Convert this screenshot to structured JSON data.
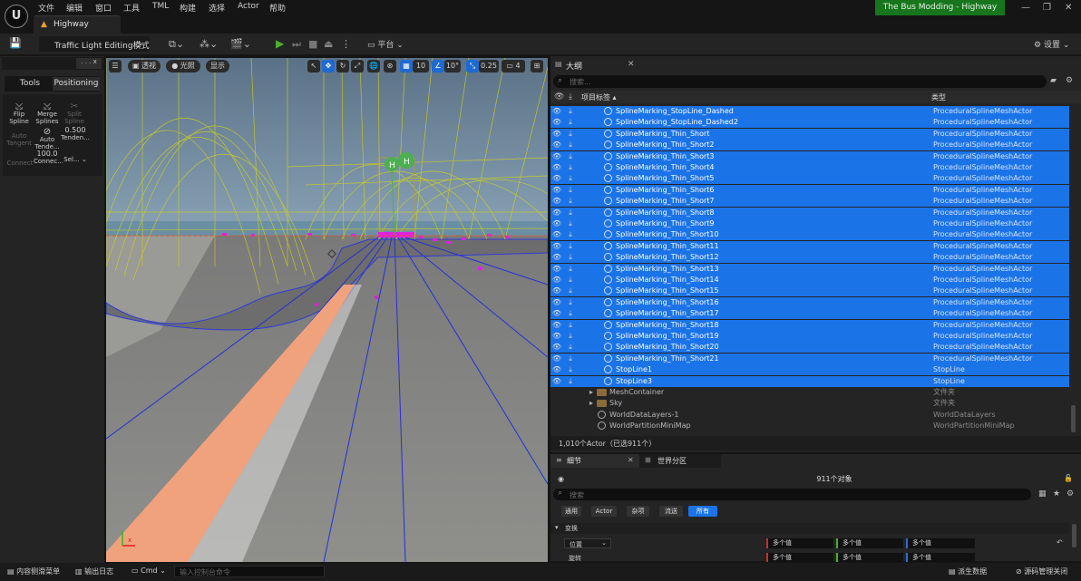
{
  "menu": [
    "文件",
    "编辑",
    "窗口",
    "工具",
    "TML",
    "构建",
    "选择",
    "Actor",
    "帮助"
  ],
  "tab": {
    "title": "Highway"
  },
  "project": "The Bus Modding - Highway",
  "toolbar": {
    "mode": "Traffic Light Editing模式",
    "platform": "平台",
    "settings": "设置"
  },
  "left_panel": {
    "tab_dots": ". . . x",
    "tabs": [
      "Tools",
      "Positioning"
    ],
    "tools": {
      "flip": "Flip Spline",
      "merge": "Merge Splines",
      "split": "Split Spline",
      "auto_tangent": "Auto Tangent",
      "auto_tende": "Auto Tende...",
      "tenden_value": "0.500",
      "tenden_label": "Tenden...",
      "connect": "Connect",
      "connect_value": "100.0",
      "connect_label": "Connec...",
      "sel": "Sel..."
    }
  },
  "viewport": {
    "perspective": "透视",
    "lit": "光照",
    "show": "显示",
    "grid_snap": "10",
    "rot_snap": "10°",
    "scale_snap": "0.25",
    "camera_speed": "4"
  },
  "outliner": {
    "title": "大纲",
    "search_placeholder": "搜索...",
    "col_label": "项目标签",
    "col_type": "类型",
    "rows": [
      {
        "name": "SplineMarking_StopLine_Dashed",
        "type": "ProceduralSplineMeshActor",
        "selected": true,
        "kind": "actor"
      },
      {
        "name": "SplineMarking_StopLine_Dashed2",
        "type": "ProceduralSplineMeshActor",
        "selected": true,
        "kind": "actor"
      },
      {
        "name": "SplineMarking_Thin_Short",
        "type": "ProceduralSplineMeshActor",
        "selected": true,
        "kind": "actor"
      },
      {
        "name": "SplineMarking_Thin_Short2",
        "type": "ProceduralSplineMeshActor",
        "selected": true,
        "kind": "actor"
      },
      {
        "name": "SplineMarking_Thin_Short3",
        "type": "ProceduralSplineMeshActor",
        "selected": true,
        "kind": "actor"
      },
      {
        "name": "SplineMarking_Thin_Short4",
        "type": "ProceduralSplineMeshActor",
        "selected": true,
        "kind": "actor"
      },
      {
        "name": "SplineMarking_Thin_Short5",
        "type": "ProceduralSplineMeshActor",
        "selected": true,
        "kind": "actor"
      },
      {
        "name": "SplineMarking_Thin_Short6",
        "type": "ProceduralSplineMeshActor",
        "selected": true,
        "kind": "actor"
      },
      {
        "name": "SplineMarking_Thin_Short7",
        "type": "ProceduralSplineMeshActor",
        "selected": true,
        "kind": "actor"
      },
      {
        "name": "SplineMarking_Thin_Short8",
        "type": "ProceduralSplineMeshActor",
        "selected": true,
        "kind": "actor"
      },
      {
        "name": "SplineMarking_Thin_Short9",
        "type": "ProceduralSplineMeshActor",
        "selected": true,
        "kind": "actor"
      },
      {
        "name": "SplineMarking_Thin_Short10",
        "type": "ProceduralSplineMeshActor",
        "selected": true,
        "kind": "actor"
      },
      {
        "name": "SplineMarking_Thin_Short11",
        "type": "ProceduralSplineMeshActor",
        "selected": true,
        "kind": "actor"
      },
      {
        "name": "SplineMarking_Thin_Short12",
        "type": "ProceduralSplineMeshActor",
        "selected": true,
        "kind": "actor"
      },
      {
        "name": "SplineMarking_Thin_Short13",
        "type": "ProceduralSplineMeshActor",
        "selected": true,
        "kind": "actor"
      },
      {
        "name": "SplineMarking_Thin_Short14",
        "type": "ProceduralSplineMeshActor",
        "selected": true,
        "kind": "actor"
      },
      {
        "name": "SplineMarking_Thin_Short15",
        "type": "ProceduralSplineMeshActor",
        "selected": true,
        "kind": "actor"
      },
      {
        "name": "SplineMarking_Thin_Short16",
        "type": "ProceduralSplineMeshActor",
        "selected": true,
        "kind": "actor"
      },
      {
        "name": "SplineMarking_Thin_Short17",
        "type": "ProceduralSplineMeshActor",
        "selected": true,
        "kind": "actor"
      },
      {
        "name": "SplineMarking_Thin_Short18",
        "type": "ProceduralSplineMeshActor",
        "selected": true,
        "kind": "actor"
      },
      {
        "name": "SplineMarking_Thin_Short19",
        "type": "ProceduralSplineMeshActor",
        "selected": true,
        "kind": "actor"
      },
      {
        "name": "SplineMarking_Thin_Short20",
        "type": "ProceduralSplineMeshActor",
        "selected": true,
        "kind": "actor"
      },
      {
        "name": "SplineMarking_Thin_Short21",
        "type": "ProceduralSplineMeshActor",
        "selected": true,
        "kind": "actor"
      },
      {
        "name": "StopLine1",
        "type": "StopLine",
        "selected": true,
        "kind": "actor"
      },
      {
        "name": "StopLine3",
        "type": "StopLine",
        "selected": true,
        "kind": "actor"
      },
      {
        "name": "MeshContainer",
        "type": "文件夹",
        "selected": false,
        "kind": "folder"
      },
      {
        "name": "Sky",
        "type": "文件夹",
        "selected": false,
        "kind": "folder"
      },
      {
        "name": "WorldDataLayers-1",
        "type": "WorldDataLayers",
        "selected": false,
        "kind": "actor"
      },
      {
        "name": "WorldPartitionMiniMap",
        "type": "WorldPartitionMiniMap",
        "selected": false,
        "kind": "actor"
      }
    ],
    "footer": "1,010个Actor（已选911个）"
  },
  "details": {
    "tab1": "细节",
    "tab2": "世界分区",
    "count": "911个对象",
    "search_placeholder": "搜索",
    "filters": [
      "通用",
      "Actor",
      "杂项",
      "流送",
      "所有"
    ],
    "section": "变换",
    "location": "位置",
    "rotation": "旋转",
    "multi": "多个值"
  },
  "statusbar": {
    "content_drawer": "内容侧滑菜单",
    "output_log": "输出日志",
    "cmd": "Cmd",
    "cmd_placeholder": "输入控制台命令",
    "derived": "派生数据",
    "source_control": "源码管理关闭"
  },
  "colors": {
    "accent": "#1b73e8",
    "project_badge": "#17761d",
    "play": "#4caf2a"
  }
}
